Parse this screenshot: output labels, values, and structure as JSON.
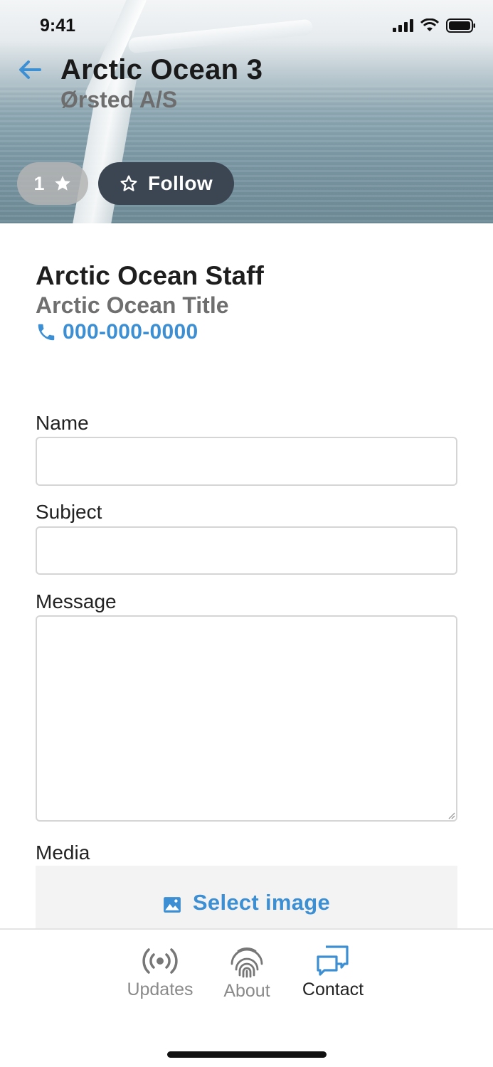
{
  "status_bar": {
    "time": "9:41"
  },
  "header": {
    "title": "Arctic Ocean 3",
    "subtitle": "Ørsted A/S",
    "rating_count": "1",
    "follow_label": "Follow"
  },
  "contact": {
    "name": "Arctic Ocean Staff",
    "title": "Arctic Ocean Title",
    "phone": "000-000-0000"
  },
  "form": {
    "name_label": "Name",
    "name_value": "",
    "subject_label": "Subject",
    "subject_value": "",
    "message_label": "Message",
    "message_value": "",
    "media_label": "Media",
    "select_image_label": "Select image"
  },
  "tabs": [
    {
      "label": "Updates",
      "icon": "broadcast-icon",
      "active": false
    },
    {
      "label": "About",
      "icon": "fingerprint-icon",
      "active": false
    },
    {
      "label": "Contact",
      "icon": "chat-icon",
      "active": true
    }
  ],
  "colors": {
    "accent": "#3d8fd4",
    "follow_button": "#3b4652",
    "rating_pill": "#b4b4b4"
  }
}
